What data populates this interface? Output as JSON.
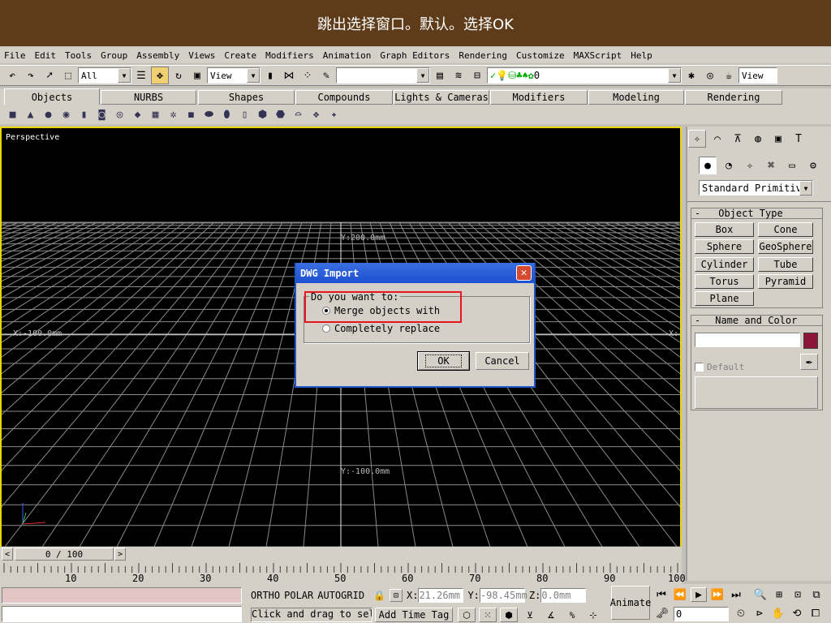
{
  "banner": {
    "text": "跳出选择窗口。默认。选择OK"
  },
  "menu": [
    "File",
    "Edit",
    "Tools",
    "Group",
    "Assembly",
    "Views",
    "Create",
    "Modifiers",
    "Animation",
    "Graph Editors",
    "Rendering",
    "Customize",
    "MAXScript",
    "Help"
  ],
  "toolbar": {
    "selection_filter": "All",
    "ref_coord": "View",
    "named_selection": "",
    "layer": "0",
    "view_right": "View"
  },
  "tabs": [
    "Objects",
    "NURBS",
    "Shapes",
    "Compounds",
    "Lights & Cameras",
    "Modifiers",
    "Modeling",
    "Rendering"
  ],
  "viewport": {
    "label": "Perspective",
    "y_top": "Y:200.0mm",
    "y_bottom": "Y:-100.0mm",
    "x_left": "X:-100.0mm",
    "x_right": "X:"
  },
  "panel": {
    "category": "Standard Primitiv",
    "object_type_title": "Object Type",
    "buttons": [
      "Box",
      "Cone",
      "Sphere",
      "GeoSphere",
      "Cylinder",
      "Tube",
      "Torus",
      "Pyramid",
      "Plane"
    ],
    "name_color_title": "Name and Color",
    "name_value": "",
    "color": "#8b1438",
    "default_label": "Default"
  },
  "dialog": {
    "title": "DWG Import",
    "group": "Do you want to:",
    "option1": "Merge objects with",
    "option2": "Completely replace",
    "ok": "OK",
    "cancel": "Cancel"
  },
  "timeline": {
    "frame": "0 / 100",
    "ticks": [
      "10",
      "20",
      "30",
      "40",
      "50",
      "60",
      "70",
      "80",
      "90",
      "100"
    ]
  },
  "status": {
    "ortho": "ORTHO",
    "polar": "POLAR",
    "autogrid": "AUTOGRID",
    "x": "21.26mm",
    "y": "-98.45mm",
    "z": "0.0mm",
    "x_label": "X:",
    "y_label": "Y:",
    "z_label": "Z:",
    "prompt": "Click and drag to sel",
    "add_time_tag": "Add Time Tag",
    "animate": "Animate",
    "frame_field": "0"
  },
  "colors": {
    "banner": "#5e3b19",
    "viewport_border": "#e8d800",
    "highlight_box": "#e8161c",
    "dialog_title": "#2a62dc"
  }
}
